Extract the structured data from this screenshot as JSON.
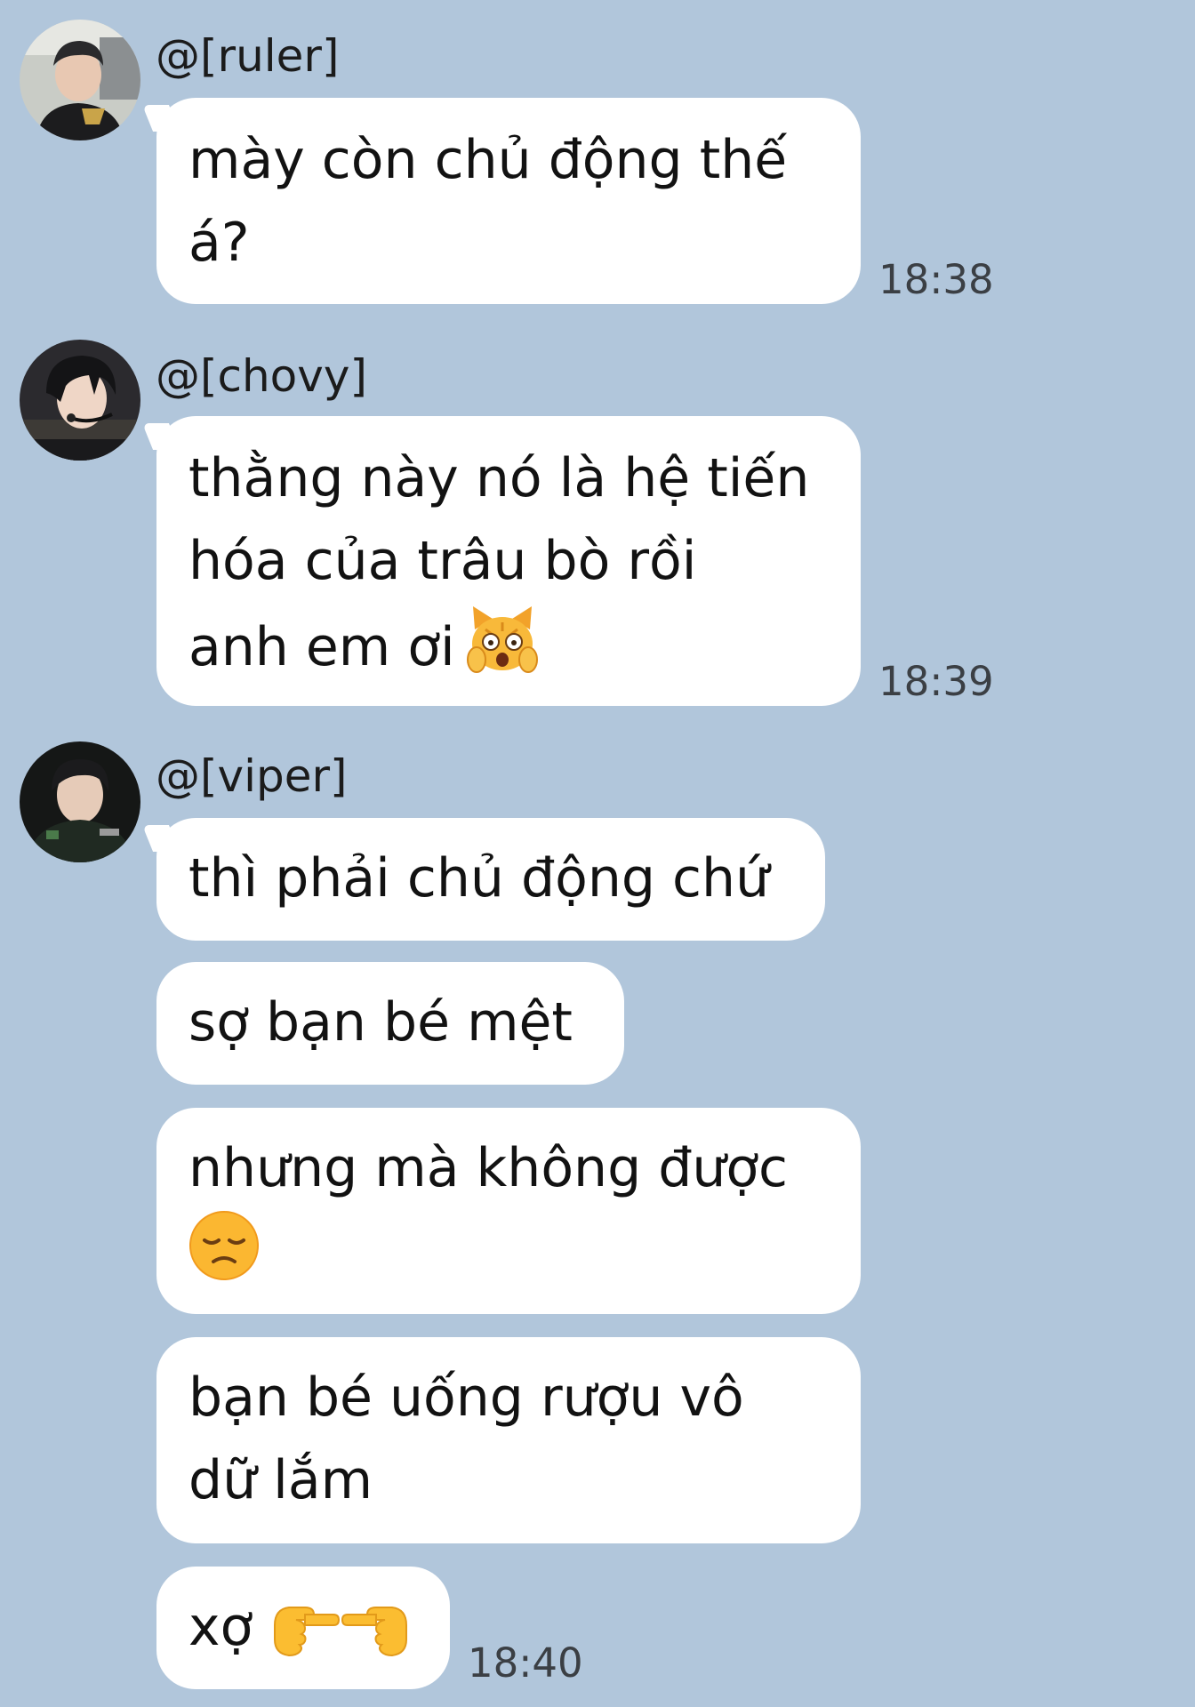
{
  "colors": {
    "background": "#b1c6db",
    "bubble": "#ffffff",
    "text": "#121212",
    "timestamp": "#3b3f44"
  },
  "messages": [
    {
      "sender": "@[ruler]",
      "avatar": "ruler-avatar",
      "bubbles": [
        {
          "lines": [
            "mày còn chủ động thế",
            "á?"
          ]
        }
      ],
      "time": "18:38"
    },
    {
      "sender": "@[chovy]",
      "avatar": "chovy-avatar",
      "bubbles": [
        {
          "lines": [
            "thằng này nó là hệ tiến",
            "hóa của trâu bò rồi",
            "anh em ơi"
          ],
          "emoji": "weary-cat-face-emoji"
        }
      ],
      "time": "18:39"
    },
    {
      "sender": "@[viper]",
      "avatar": "viper-avatar",
      "bubbles": [
        {
          "lines": [
            "thì phải chủ động chứ"
          ]
        },
        {
          "lines": [
            "sợ bạn bé mệt"
          ]
        },
        {
          "lines": [
            "nhưng mà không được"
          ],
          "emoji": "disappointed-face-emoji"
        },
        {
          "lines": [
            "bạn bé uống rượu vô",
            "dữ lắm"
          ]
        },
        {
          "lines": [
            "xợ"
          ],
          "emoji": "index-pointing-hands-emoji"
        }
      ],
      "time": "18:40"
    }
  ]
}
